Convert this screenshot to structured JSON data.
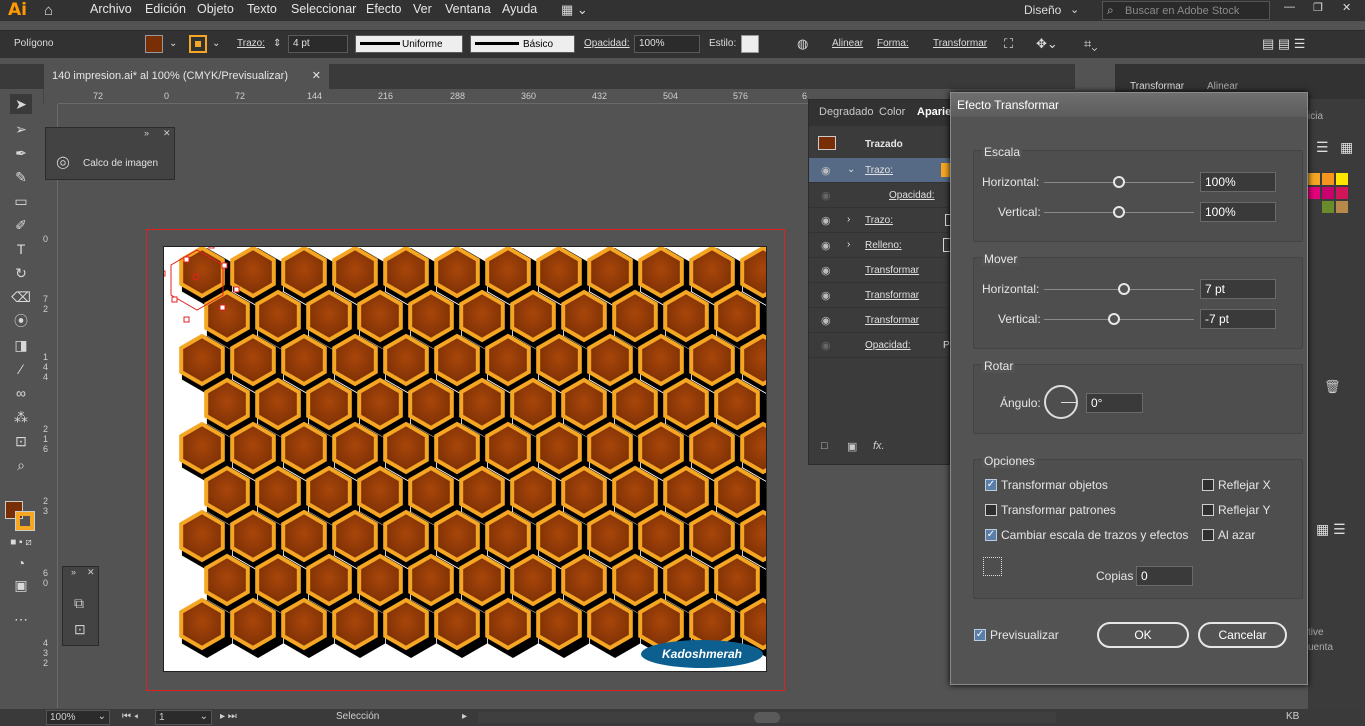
{
  "app": {
    "logo": "Ai"
  },
  "menu": [
    "Archivo",
    "Edición",
    "Objeto",
    "Texto",
    "Seleccionar",
    "Efecto",
    "Ver",
    "Ventana",
    "Ayuda"
  ],
  "workspace": "Diseño",
  "search_placeholder": "Buscar en Adobe Stock",
  "control": {
    "object_type": "Polígono",
    "stroke_label": "Trazo:",
    "stroke_value": "4 pt",
    "profile": "Uniforme",
    "brush": "Básico",
    "opacity_label": "Opacidad:",
    "opacity_value": "100%",
    "style_label": "Estilo:",
    "align": "Alinear",
    "shape": "Forma:",
    "transform": "Transformar",
    "fill_color": "#7a2e05",
    "stroke_color": "#f5a623"
  },
  "document_tab": "140 impresion.ai* al 100% (CMYK/Previsualizar)",
  "ruler_top": [
    "72",
    "0",
    "72",
    "144",
    "216",
    "288",
    "360",
    "432",
    "504",
    "576",
    "6"
  ],
  "ruler_left": [
    "0",
    "7",
    "2",
    "1",
    "4",
    "4",
    "2",
    "1",
    "6",
    "2",
    "3",
    "6",
    "0",
    "4",
    "3",
    "2"
  ],
  "float_panel": {
    "label": "Calco de imagen"
  },
  "appearance": {
    "tabs": [
      "Degradado",
      "Color",
      "Aparien"
    ],
    "path_label": "Trazado",
    "rows": [
      {
        "label": "Trazo:",
        "selected": true
      },
      {
        "label": "Opacidad:",
        "indent": true
      },
      {
        "label": "Trazo:"
      },
      {
        "label": "Relleno:"
      },
      {
        "label": "Transformar"
      },
      {
        "label": "Transformar"
      },
      {
        "label": "Transformar"
      },
      {
        "label": "Opacidad:"
      }
    ],
    "opacity_suffix": "P"
  },
  "right_dock": {
    "tabs": [
      "Transformar",
      "Alinear"
    ],
    "partial_1": "icia",
    "partial_2": "tive",
    "partial_3": "uenta"
  },
  "dialog": {
    "title": "Efecto Transformar",
    "scale": {
      "title": "Escala",
      "h_label": "Horizontal:",
      "h_value": "100%",
      "v_label": "Vertical:",
      "v_value": "100%"
    },
    "move": {
      "title": "Mover",
      "h_label": "Horizontal:",
      "h_value": "7 pt",
      "v_label": "Vertical:",
      "v_value": "-7 pt"
    },
    "rotate": {
      "title": "Rotar",
      "angle_label": "Ángulo:",
      "angle_value": "0°"
    },
    "options": {
      "title": "Opciones",
      "transform_objects": "Transformar objetos",
      "transform_patterns": "Transformar patrones",
      "scale_strokes": "Cambiar escala de trazos y efectos",
      "reflect_x": "Reflejar X",
      "reflect_y": "Reflejar Y",
      "random": "Al azar",
      "copies_label": "Copias",
      "copies_value": "0"
    },
    "preview": "Previsualizar",
    "ok": "OK",
    "cancel": "Cancelar"
  },
  "artwork": {
    "watermark": "Kadoshmerah",
    "hex_fill": "#7a2e05",
    "hex_stroke": "#f5a623"
  },
  "status": {
    "zoom": "100%",
    "artboard": "1",
    "tool": "Selección",
    "kb": "KB"
  }
}
